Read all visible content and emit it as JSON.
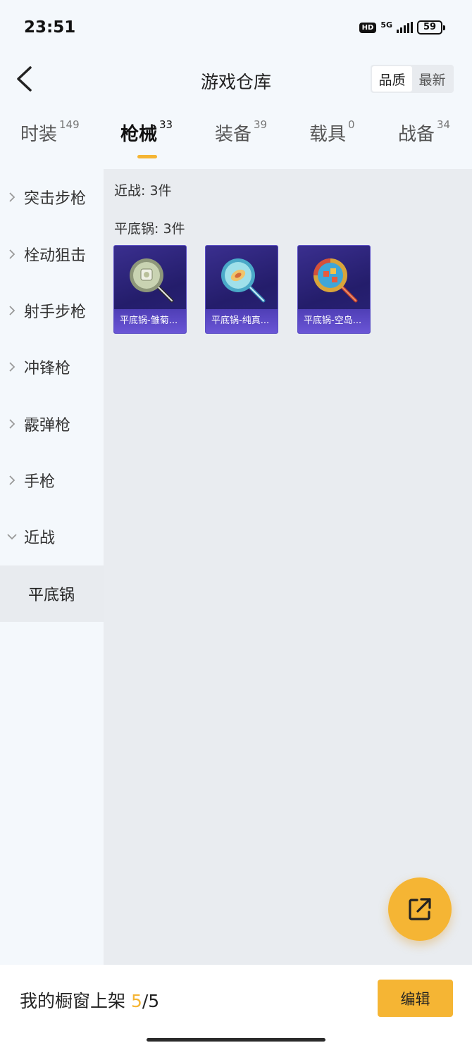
{
  "status_bar": {
    "time": "23:51",
    "hd": "HD",
    "network": "5G",
    "battery": "59"
  },
  "header": {
    "title": "游戏仓库",
    "back_icon": "chevron-left-icon",
    "sort_options": [
      "品质",
      "最新"
    ],
    "sort_selected": "品质"
  },
  "tabs": [
    {
      "label": "时装",
      "count": "149"
    },
    {
      "label": "枪械",
      "count": "33",
      "active": true
    },
    {
      "label": "装备",
      "count": "39"
    },
    {
      "label": "载具",
      "count": "0"
    },
    {
      "label": "战备",
      "count": "34"
    }
  ],
  "sidebar": {
    "items": [
      {
        "label": "突击步枪"
      },
      {
        "label": "栓动狙击"
      },
      {
        "label": "射手步枪"
      },
      {
        "label": "冲锋枪"
      },
      {
        "label": "霰弹枪"
      },
      {
        "label": "手枪"
      },
      {
        "label": "近战",
        "expanded": true
      }
    ],
    "sub_item": "平底锅"
  },
  "content": {
    "group_label": "近战: 3件",
    "subgroup_label": "平底锅: 3件",
    "items": [
      {
        "name": "平底锅-雏菊...",
        "icon": "frying-pan-icon",
        "color": "#c9d3b2"
      },
      {
        "name": "平底锅-纯真...",
        "icon": "frying-pan-icon",
        "color": "#7fd0e0"
      },
      {
        "name": "平底锅-空岛...",
        "icon": "frying-pan-icon",
        "color": "#3fa6d8"
      }
    ]
  },
  "fab": {
    "icon": "share-external-icon"
  },
  "bottom": {
    "shelf_prefix": "我的橱窗上架 ",
    "shelf_current": "5",
    "shelf_total": "/5",
    "edit_label": "编辑"
  },
  "colors": {
    "accent": "#f5b534",
    "card_bg": "#2a2479"
  }
}
